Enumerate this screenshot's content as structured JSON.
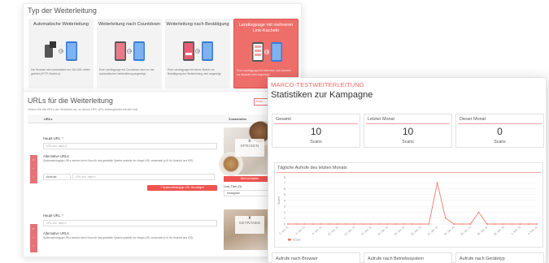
{
  "redirect_type": {
    "title": "Typ der Weiterleitung",
    "options": [
      {
        "title": "Automatische Weiterleitung",
        "desc": "Der Browser wird automatisch zur Ziel-URL weiter geleitet (HTTP-Redirect).",
        "selected": false
      },
      {
        "title": "Weiterleitung nach Countdown",
        "desc": "Eine Landingpage mit Countdown wird vor der automatischen Weiterleitung angezeigt.",
        "selected": false
      },
      {
        "title": "Weiterleitung nach Bestätigung",
        "desc": "Eine Landingpage mit einem Button zur Bestätigung der Weiterleitung wird angezeigt.",
        "selected": false
      },
      {
        "title": "Landingpage mit mehreren Link-Kacheln",
        "desc": "Eine Landingpage mit mehreren Link-Kacheln zur Auswahl wird angezeigt.",
        "selected": true
      }
    ]
  },
  "urls": {
    "title": "URLs für die Weiterleitung",
    "subtitle": "Geben Sie die URLs der Zielseiten an, zu denen NFC-URL weitergeleitet werden soll.",
    "help_button": "Erste...",
    "col_urls": "URLs",
    "col_extra": "Zusatzinfos",
    "rows": [
      {
        "main_label": "Haupt-URL: *",
        "main_placeholder": "URL inkl. https://",
        "alt_label": "Alternative URLs:",
        "alt_hint": "Systemabhängige URLs werden beim Scan für das gewählte System anstelle der Haupt-URL verwendet (z.B. für Android und iOS).",
        "os_select": "Android",
        "alt_placeholder": "URL inkl. https://",
        "add_button": "+ Systemabhängige URL hinzufügen",
        "image_label": "SPEISEN",
        "image_button": "Bild hochladen",
        "linktext_label": "Link-Titel (0)",
        "linktext_value": "Instagram"
      },
      {
        "main_label": "Haupt-URL: *",
        "main_placeholder": "URL inkl. https://",
        "alt_label": "Alternative URLs:",
        "alt_hint": "Systemabhängige URLs werden beim Scan für das gewählte System anstelle der Haupt-URL verwendet (z.B. für Android und iOS).",
        "image_label": "GETRÄNKE"
      }
    ]
  },
  "stats": {
    "kicker": "MARCO-TESTWEITERLEITUNG",
    "title": "Statistiken zur Kampagne",
    "cards": [
      {
        "label": "Gesamt",
        "value": "10",
        "unit": "Scans"
      },
      {
        "label": "Letzter Monat",
        "value": "10",
        "unit": "Scans"
      },
      {
        "label": "Dieser Monat",
        "value": "0",
        "unit": "Scans"
      }
    ],
    "chart_title": "Tägliche Aufrufe des letzten Monats",
    "bottom_cards": [
      {
        "label": "Aufrufe nach Browser"
      },
      {
        "label": "Aufrufe nach Betriebssystem"
      },
      {
        "label": "Aufrufe nach Gerätetyp"
      }
    ]
  },
  "colors": {
    "accent": "#e76a64",
    "line": "#ef7b6b",
    "selected": "#ee6e6a"
  },
  "chart_data": {
    "type": "line",
    "title": "Tägliche Aufrufe des letzten Monats",
    "ylabel": "Scans",
    "ylim": [
      0,
      8
    ],
    "yticks": [
      "0",
      "1",
      "2",
      "3",
      "4",
      "5",
      "6",
      "7",
      "8"
    ],
    "categories": [
      "4. Jan. 21",
      "5. Jan. 21",
      "6. Jan. 21",
      "7. Jan. 21",
      "8. Jan. 21",
      "9. Jan. 21",
      "10. Jan. 21",
      "11. Jan. 21",
      "12. Jan. 21",
      "13. Jan. 21",
      "14. Jan. 21",
      "15. Jan. 21",
      "16. Jan. 21",
      "17. Jan. 21",
      "18. Jan. 21",
      "19. Jan. 21",
      "20. Jan. 21",
      "21. Jan. 21",
      "22. Jan. 21",
      "23. Jan. 21",
      "24. Jan. 21",
      "25. Jan. 21",
      "26. Jan. 21",
      "27. Jan. 21",
      "28. Jan. 21",
      "29. Jan. 21",
      "30. Jan. 21",
      "31. Jan. 21",
      "1. Feb. 21",
      "2. Feb. 21",
      "3. Feb. 21"
    ],
    "series": [
      {
        "name": "Scans",
        "values": [
          0,
          0,
          0,
          0,
          0,
          0,
          0,
          0,
          0,
          0,
          0,
          0,
          0,
          0,
          0,
          0,
          0,
          0,
          7,
          1,
          0,
          0,
          0,
          2,
          0,
          0,
          0,
          0,
          0,
          0,
          0
        ]
      }
    ]
  }
}
